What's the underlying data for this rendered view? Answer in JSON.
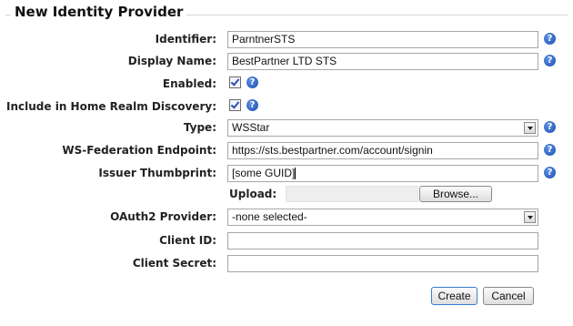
{
  "form": {
    "title": "New Identity Provider",
    "identifier": {
      "label": "Identifier:",
      "value": "ParntnerSTS"
    },
    "display_name": {
      "label": "Display Name:",
      "value": "BestPartner LTD STS"
    },
    "enabled": {
      "label": "Enabled:",
      "checked": true
    },
    "home_realm": {
      "label": "Include in Home Realm Discovery:",
      "checked": true
    },
    "type": {
      "label": "Type:",
      "selected": "WSStar"
    },
    "ws_endpoint": {
      "label": "WS-Federation Endpoint:",
      "value": "https://sts.bestpartner.com/account/signin"
    },
    "issuer_thumbprint": {
      "label": "Issuer Thumbprint:",
      "value": "[some GUID]"
    },
    "upload": {
      "label": "Upload:",
      "browse_label": "Browse..."
    },
    "oauth2": {
      "label": "OAuth2 Provider:",
      "selected": "-none selected-"
    },
    "client_id": {
      "label": "Client ID:",
      "value": ""
    },
    "client_secret": {
      "label": "Client Secret:",
      "value": ""
    },
    "help_glyph": "?",
    "create_label": "Create",
    "cancel_label": "Cancel"
  }
}
